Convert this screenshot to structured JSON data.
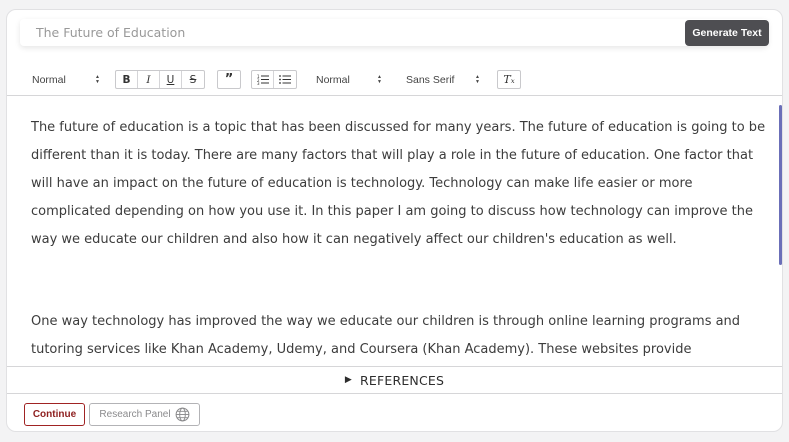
{
  "prompt": {
    "title_value": "The Future of Education",
    "generate_label": "Generate Text"
  },
  "toolbar": {
    "header_picker": "Normal",
    "bold": "B",
    "italic": "I",
    "underline": "U",
    "strike": "S",
    "blockquote": "”",
    "ordered_list": "☰",
    "bullet_list": "☰",
    "size_picker": "Normal",
    "font_picker": "Sans Serif",
    "clear_format": "Tₓ"
  },
  "editor": {
    "paragraphs": [
      "The future of education is a topic that has been discussed for many years. The future of education is going to be different than it is today. There are many factors that will play a role in the future of education. One factor that will have an impact on the future of education is technology. Technology can make life easier or more complicated depending on how you use it. In this paper I am going to discuss how technology can improve the way we educate our children and also how it can negatively affect our children's education as well.",
      "One way technology has improved the way we educate our children is through online learning programs and tutoring services like Khan Academy, Udemy, and Coursera (Khan Academy). These websites provide educational"
    ]
  },
  "references": {
    "label": "REFERENCES"
  },
  "footer": {
    "continue_label": "Continue",
    "research_label": "Research Panel"
  },
  "icons": {
    "research": "globe-icon",
    "references": "triangle-right-icon"
  },
  "colors": {
    "generate_bg": "#4e4e52",
    "continue_border": "#a02323",
    "scroll_accent": "#6b6fb8"
  }
}
